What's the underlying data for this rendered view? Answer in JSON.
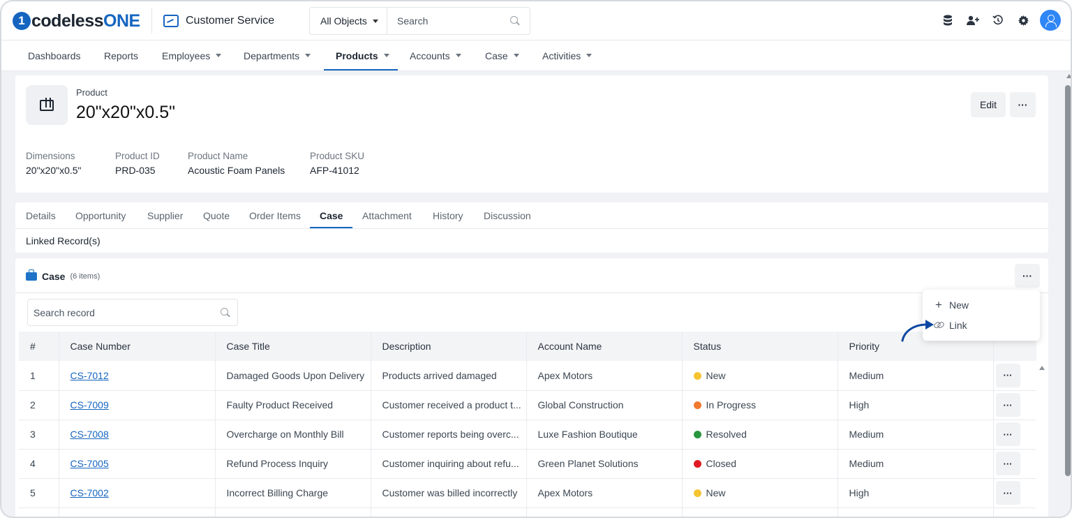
{
  "header": {
    "logo_mark": "1",
    "logo_text_dark": "codeless",
    "logo_text_blue": "ONE",
    "app_name": "Customer Service",
    "objects_select": "All Objects",
    "search_placeholder": "Search",
    "icons": [
      "database-icon",
      "add-user-icon",
      "history-icon",
      "gear-icon",
      "user-avatar-icon"
    ]
  },
  "nav": {
    "items": [
      {
        "label": "Dashboards",
        "dropdown": false
      },
      {
        "label": "Reports",
        "dropdown": false
      },
      {
        "label": "Employees",
        "dropdown": true
      },
      {
        "label": "Departments",
        "dropdown": true
      },
      {
        "label": "Products",
        "dropdown": true,
        "active": true
      },
      {
        "label": "Accounts",
        "dropdown": true
      },
      {
        "label": "Case",
        "dropdown": true
      },
      {
        "label": "Activities",
        "dropdown": true
      }
    ]
  },
  "product": {
    "type_label": "Product",
    "title": "20\"x20\"x0.5\"",
    "edit_label": "Edit",
    "more_label": "···",
    "fields": [
      {
        "label": "Dimensions",
        "value": "20\"x20\"x0.5\""
      },
      {
        "label": "Product ID",
        "value": "PRD-035"
      },
      {
        "label": "Product Name",
        "value": "Acoustic Foam Panels"
      },
      {
        "label": "Product SKU",
        "value": "AFP-41012"
      }
    ]
  },
  "tabs": {
    "items": [
      "Details",
      "Opportunity",
      "Supplier",
      "Quote",
      "Order Items",
      "Case",
      "Attachment",
      "History",
      "Discussion"
    ],
    "active": "Case",
    "sub_label": "Linked Record(s)"
  },
  "case_section": {
    "title": "Case",
    "count": "(6 items)",
    "more_label": "···",
    "search_placeholder": "Search record",
    "menu": {
      "new_label": "New",
      "link_label": "Link"
    },
    "columns": [
      "#",
      "Case Number",
      "Case Title",
      "Description",
      "Account Name",
      "Status",
      "Priority",
      ""
    ],
    "rows": [
      {
        "num": "1",
        "case_no": "CS-7012",
        "title": "Damaged Goods Upon Delivery",
        "desc": "Products arrived damaged",
        "account": "Apex Motors",
        "status": "New",
        "status_color": "#f5c431",
        "priority": "Medium"
      },
      {
        "num": "2",
        "case_no": "CS-7009",
        "title": "Faulty Product Received",
        "desc": "Customer received a product t...",
        "account": "Global Construction",
        "status": "In Progress",
        "status_color": "#f07a2e",
        "priority": "High"
      },
      {
        "num": "3",
        "case_no": "CS-7008",
        "title": "Overcharge on Monthly Bill",
        "desc": "Customer reports being overc...",
        "account": "Luxe Fashion Boutique",
        "status": "Resolved",
        "status_color": "#27963f",
        "priority": "Medium"
      },
      {
        "num": "4",
        "case_no": "CS-7005",
        "title": "Refund Process Inquiry",
        "desc": "Customer inquiring about refu...",
        "account": "Green Planet Solutions",
        "status": "Closed",
        "status_color": "#e11b22",
        "priority": "Medium"
      },
      {
        "num": "5",
        "case_no": "CS-7002",
        "title": "Incorrect Billing Charge",
        "desc": "Customer was billed incorrectly",
        "account": "Apex Motors",
        "status": "New",
        "status_color": "#f5c431",
        "priority": "High"
      }
    ]
  },
  "colors": {
    "accent": "#1565c0",
    "avatar": "#2f86f6"
  }
}
